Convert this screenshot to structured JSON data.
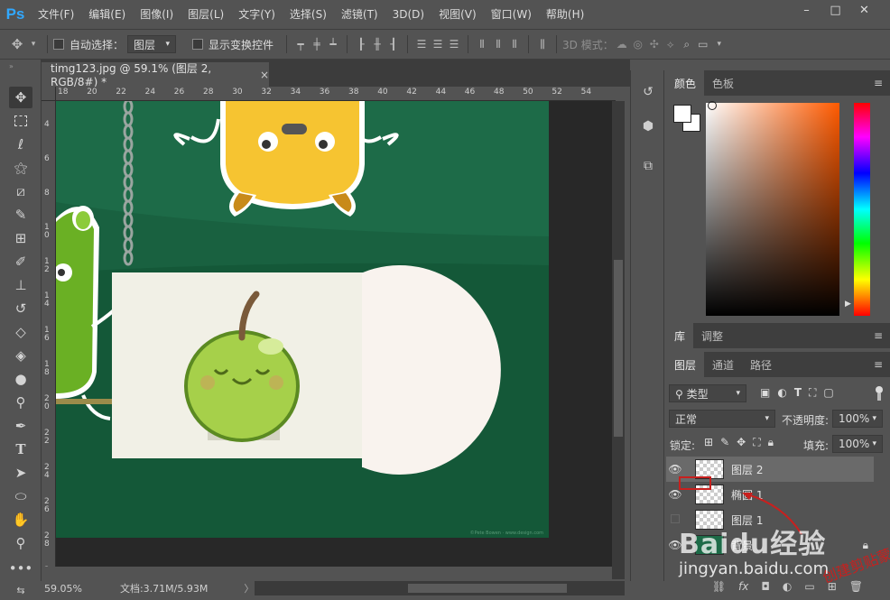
{
  "app": {
    "logo": "Ps"
  },
  "menu": [
    "文件(F)",
    "编辑(E)",
    "图像(I)",
    "图层(L)",
    "文字(Y)",
    "选择(S)",
    "滤镜(T)",
    "3D(D)",
    "视图(V)",
    "窗口(W)",
    "帮助(H)"
  ],
  "window_controls": {
    "minimize": "–",
    "restore": "□",
    "close": "✕"
  },
  "options": {
    "auto_select_label": "自动选择：",
    "auto_select_value": "图层",
    "show_transform_label": "显示变换控件",
    "mode_3d_label": "3D 模式："
  },
  "document": {
    "tab_title": "timg123.jpg @ 59.1% (图层 2, RGB/8#) *",
    "tab_close": "×",
    "ruler_h": [
      "18",
      "20",
      "22",
      "24",
      "26",
      "28",
      "30",
      "32",
      "34",
      "36",
      "38",
      "40",
      "42",
      "44",
      "46",
      "48",
      "50",
      "52",
      "54"
    ],
    "ruler_v": [
      "4",
      "6",
      "8",
      "1 0",
      "1 2",
      "1 4",
      "1 6",
      "1 8",
      "2 0",
      "2 2",
      "2 4",
      "2 6",
      "2 8",
      "3 0"
    ],
    "watermark_credit": "©Pete Bowen · www.design.com"
  },
  "status": {
    "zoom": "59.05%",
    "doc_size": "文档:3.71M/5.93M",
    "arrow": "〉"
  },
  "color_panel": {
    "tabs": [
      "颜色",
      "色板"
    ],
    "active_tab": 0,
    "menu_icon": "≡"
  },
  "library_panel": {
    "tabs": [
      "库",
      "调整"
    ],
    "active_tab": 0,
    "menu_icon": "≡"
  },
  "layers_panel": {
    "tabs": [
      "图层",
      "通道",
      "路径"
    ],
    "active_tab": 0,
    "menu_icon": "≡",
    "filter_label": "类型",
    "blend_mode": "正常",
    "opacity_label": "不透明度:",
    "opacity_value": "100%",
    "lock_label": "锁定:",
    "fill_label": "填充:",
    "fill_value": "100%",
    "layers": [
      {
        "name": "图层 2",
        "visible": true,
        "selected": true
      },
      {
        "name": "椭圆 1",
        "visible": true,
        "selected": false
      },
      {
        "name": "图层 1",
        "visible": false,
        "selected": false
      },
      {
        "name": "背景",
        "visible": true,
        "selected": false
      }
    ],
    "bottom_icons": [
      "link-icon",
      "fx-icon",
      "mask-icon",
      "adjustment-icon",
      "folder-icon",
      "new-layer-icon",
      "trash-icon"
    ],
    "annotation_text": "创建剪贴蒙版"
  },
  "overlay_watermark": {
    "brand": "Baidu经验",
    "url": "jingyan.baidu.com"
  },
  "colors": {
    "ui_bg": "#535353",
    "canvas_green": "#1d6b48",
    "accent_blue": "#31a8ff",
    "annotation_red": "#c8201e"
  }
}
